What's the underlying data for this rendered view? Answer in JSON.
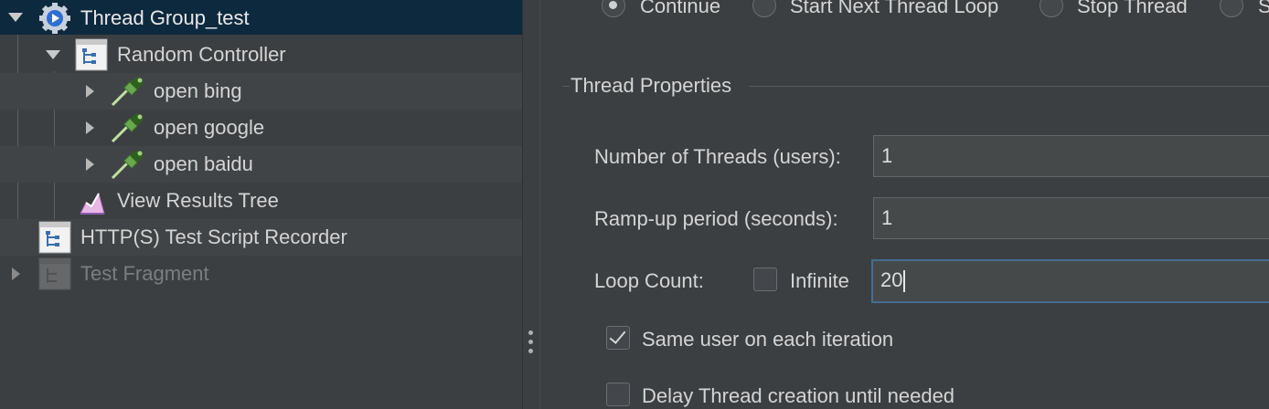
{
  "tree": {
    "nodes": [
      {
        "label": "Thread Group_test",
        "icon": "gear-icon",
        "expanded": true
      },
      {
        "label": "Random Controller",
        "icon": "controller-icon",
        "expanded": true
      },
      {
        "label": "open bing",
        "icon": "pipette-icon",
        "expanded": false
      },
      {
        "label": "open google",
        "icon": "pipette-icon",
        "expanded": false
      },
      {
        "label": "open baidu",
        "icon": "pipette-icon",
        "expanded": false
      },
      {
        "label": "View Results Tree",
        "icon": "chart-icon"
      },
      {
        "label": "HTTP(S) Test Script Recorder",
        "icon": "controller-icon"
      },
      {
        "label": "Test Fragment",
        "icon": "controller-icon",
        "disabled": true,
        "expanded": false
      }
    ]
  },
  "config": {
    "on_error": {
      "options": [
        "Continue",
        "Start Next Thread Loop",
        "Stop Thread",
        "S"
      ],
      "selected": "Continue"
    },
    "thread_properties": {
      "legend": "Thread Properties",
      "num_threads_label": "Number of Threads (users):",
      "num_threads_value": "1",
      "ramp_up_label": "Ramp-up period (seconds):",
      "ramp_up_value": "1",
      "loop_count_label": "Loop Count:",
      "infinite_label": "Infinite",
      "infinite_checked": false,
      "loop_count_value": "20",
      "same_user_label": "Same user on each iteration",
      "same_user_checked": true,
      "delay_label": "Delay Thread creation until needed",
      "delay_checked": false
    }
  },
  "colors": {
    "background": "#3c3f41",
    "selected_row": "#0d293e",
    "focus_border": "#466d94"
  }
}
